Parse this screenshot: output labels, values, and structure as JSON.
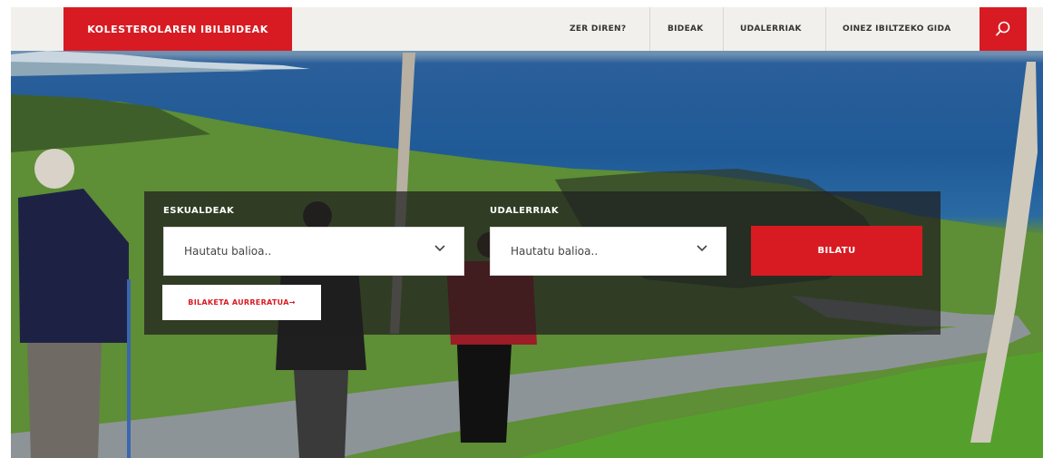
{
  "brand": {
    "title": "KOLESTEROLAREN IBILBIDEAK"
  },
  "nav": {
    "items": [
      {
        "label": "ZER DIREN?"
      },
      {
        "label": "BIDEAK"
      },
      {
        "label": "UDALERRIAK"
      },
      {
        "label": "OINEZ IBILTZEKO GIDA"
      }
    ],
    "search_icon": "search-icon"
  },
  "search": {
    "region": {
      "label": "ESKUALDEAK",
      "placeholder": "Hautatu balioa.."
    },
    "municipality": {
      "label": "UDALERRIAK",
      "placeholder": "Hautatu balioa.."
    },
    "submit_label": "BILATU",
    "advanced_label": "BILAKETA AURRERATUA→"
  },
  "colors": {
    "accent": "#d81b22",
    "topbar": "#f1f0ec"
  }
}
